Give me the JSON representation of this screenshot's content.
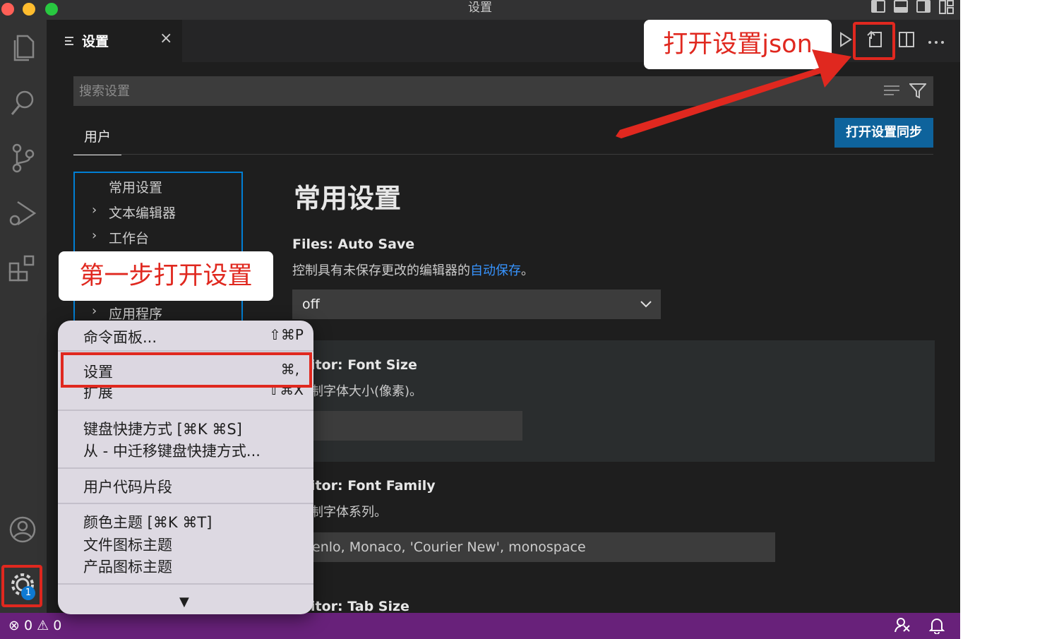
{
  "window": {
    "title": "设置"
  },
  "tab": {
    "label": "设置",
    "close": "×"
  },
  "search": {
    "placeholder": "搜索设置"
  },
  "scope": {
    "user_tab": "用户",
    "sync_button": "打开设置同步"
  },
  "toc": {
    "items": [
      {
        "label": "常用设置",
        "expandable": false
      },
      {
        "label": "文本编辑器",
        "expandable": true
      },
      {
        "label": "工作台",
        "expandable": true
      },
      {
        "label": "应用程序",
        "expandable": true
      }
    ]
  },
  "main": {
    "section_title": "常用设置",
    "settings": [
      {
        "title": "Files: Auto Save",
        "desc_prefix": "控制具有未保存更改的编辑器的",
        "desc_link": "自动保存",
        "desc_suffix": "。",
        "value": "off"
      },
      {
        "title": "itor: Font Size",
        "desc": "制字体大小(像素)。",
        "value": ""
      },
      {
        "title": "itor: Font Family",
        "desc": "制字体系列。",
        "value": "enlo, Monaco, 'Courier New', monospace"
      },
      {
        "title": "itor: Tab Size"
      }
    ]
  },
  "menu": {
    "items": [
      {
        "label": "命令面板...",
        "shortcut": "⇧⌘P"
      },
      {
        "label": "设置",
        "shortcut": "⌘,"
      },
      {
        "label": "扩展",
        "shortcut": "⇧⌘X"
      },
      {
        "label": "键盘快捷方式 [⌘K ⌘S]"
      },
      {
        "label": "从 - 中迁移键盘快捷方式..."
      },
      {
        "label": "用户代码片段"
      },
      {
        "label": "颜色主题 [⌘K ⌘T]"
      },
      {
        "label": "文件图标主题"
      },
      {
        "label": "产品图标主题"
      }
    ],
    "more_arrow": "▼"
  },
  "status": {
    "errors": "0",
    "warnings": "0"
  },
  "badges": {
    "settings_badge": "1"
  },
  "annotations": {
    "open_json": "打开设置json",
    "step_one": "第一步打开设置"
  },
  "colors": {
    "accent_red": "#e0281f",
    "status_bar": "#68217a",
    "focus_blue": "#007fd4",
    "button_blue": "#0e639c"
  }
}
